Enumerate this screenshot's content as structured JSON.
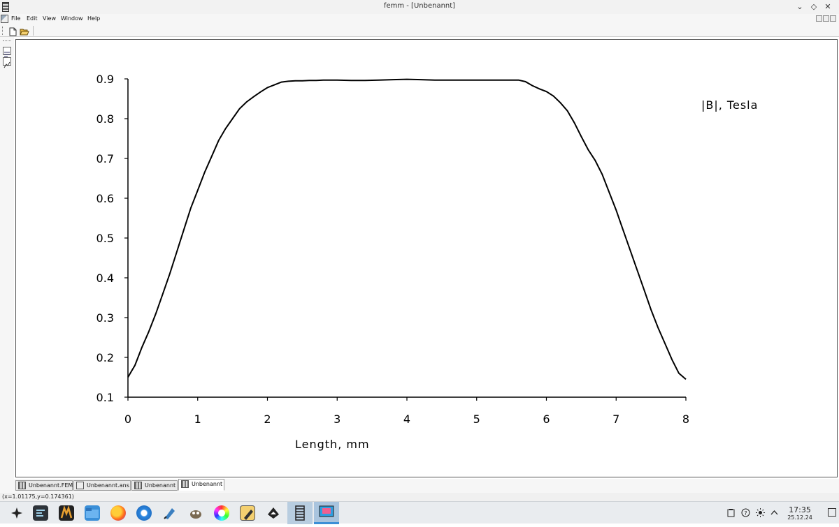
{
  "window": {
    "title": "femm - [Unbenannt]",
    "minimize_glyph": "⌄",
    "maximize_glyph": "◇",
    "close_glyph": "✕"
  },
  "menu": {
    "items": [
      "File",
      "Edit",
      "View",
      "Window",
      "Help"
    ]
  },
  "toolbar": {
    "icons": [
      "new-file-icon",
      "open-folder-icon"
    ]
  },
  "left_toolbar": {
    "icons": [
      "view-results-icon",
      "plot-edit-icon"
    ]
  },
  "chart_data": {
    "type": "line",
    "legend_label": "|B|, Tesla",
    "xlabel": "Length, mm",
    "ylabel": "",
    "xlim": [
      0,
      8
    ],
    "ylim": [
      0.1,
      0.9
    ],
    "x_ticks": [
      "0",
      "1",
      "2",
      "3",
      "4",
      "5",
      "6",
      "7",
      "8"
    ],
    "y_ticks": [
      "0.1",
      "0.2",
      "0.3",
      "0.4",
      "0.5",
      "0.6",
      "0.7",
      "0.8",
      "0.9"
    ],
    "series": [
      {
        "values_x": [
          0.0,
          0.05,
          0.1,
          0.2,
          0.3,
          0.4,
          0.5,
          0.6,
          0.7,
          0.8,
          0.9,
          1.0,
          1.1,
          1.2,
          1.3,
          1.4,
          1.5,
          1.6,
          1.7,
          1.8,
          1.9,
          2.0,
          2.1,
          2.2,
          2.3,
          2.4,
          2.5,
          2.6,
          2.7,
          2.8,
          3.0,
          3.2,
          3.4,
          3.6,
          3.8,
          4.0,
          4.2,
          4.4,
          4.6,
          4.8,
          5.0,
          5.2,
          5.4,
          5.6,
          5.7,
          5.8,
          5.9,
          6.0,
          6.1,
          6.2,
          6.3,
          6.4,
          6.5,
          6.6,
          6.7,
          6.8,
          6.9,
          7.0,
          7.1,
          7.2,
          7.3,
          7.4,
          7.5,
          7.6,
          7.7,
          7.8,
          7.9,
          8.0
        ],
        "values_y": [
          0.15,
          0.165,
          0.18,
          0.225,
          0.265,
          0.31,
          0.36,
          0.41,
          0.465,
          0.52,
          0.575,
          0.62,
          0.665,
          0.705,
          0.745,
          0.775,
          0.8,
          0.825,
          0.842,
          0.855,
          0.867,
          0.878,
          0.885,
          0.892,
          0.894,
          0.895,
          0.895,
          0.896,
          0.896,
          0.897,
          0.897,
          0.896,
          0.896,
          0.897,
          0.898,
          0.899,
          0.898,
          0.897,
          0.897,
          0.897,
          0.897,
          0.897,
          0.897,
          0.897,
          0.893,
          0.883,
          0.875,
          0.868,
          0.857,
          0.84,
          0.82,
          0.79,
          0.755,
          0.722,
          0.695,
          0.66,
          0.615,
          0.57,
          0.52,
          0.47,
          0.42,
          0.37,
          0.32,
          0.275,
          0.235,
          0.195,
          0.16,
          0.145
        ]
      }
    ]
  },
  "doc_tabs": [
    {
      "label": "Unbenannt.FEM",
      "icon": "femm-doc-icon"
    },
    {
      "label": "Unbenannt.ans",
      "icon": "solution-doc-icon"
    },
    {
      "label": "Unbenannt",
      "icon": "view-doc-icon"
    },
    {
      "label": "Unbenannt",
      "icon": "plot-doc-icon"
    }
  ],
  "status": {
    "coords": "(x=1.01175,y=0.174361)"
  },
  "taskbar": {
    "apps": [
      "app-launcher-icon",
      "terminal-icon",
      "app-m-icon",
      "file-manager-icon",
      "firefox-icon",
      "thunderbird-icon",
      "inkscape-icon",
      "gimp-icon",
      "color-picker-icon",
      "text-editor-icon",
      "inkscape-alt-icon",
      "femm-icon",
      "screenshot-icon"
    ],
    "time": "17:35",
    "date": "25.12.24"
  },
  "colors": {
    "plot_line": "#000000",
    "taskbar_active": "#a9c4de"
  }
}
